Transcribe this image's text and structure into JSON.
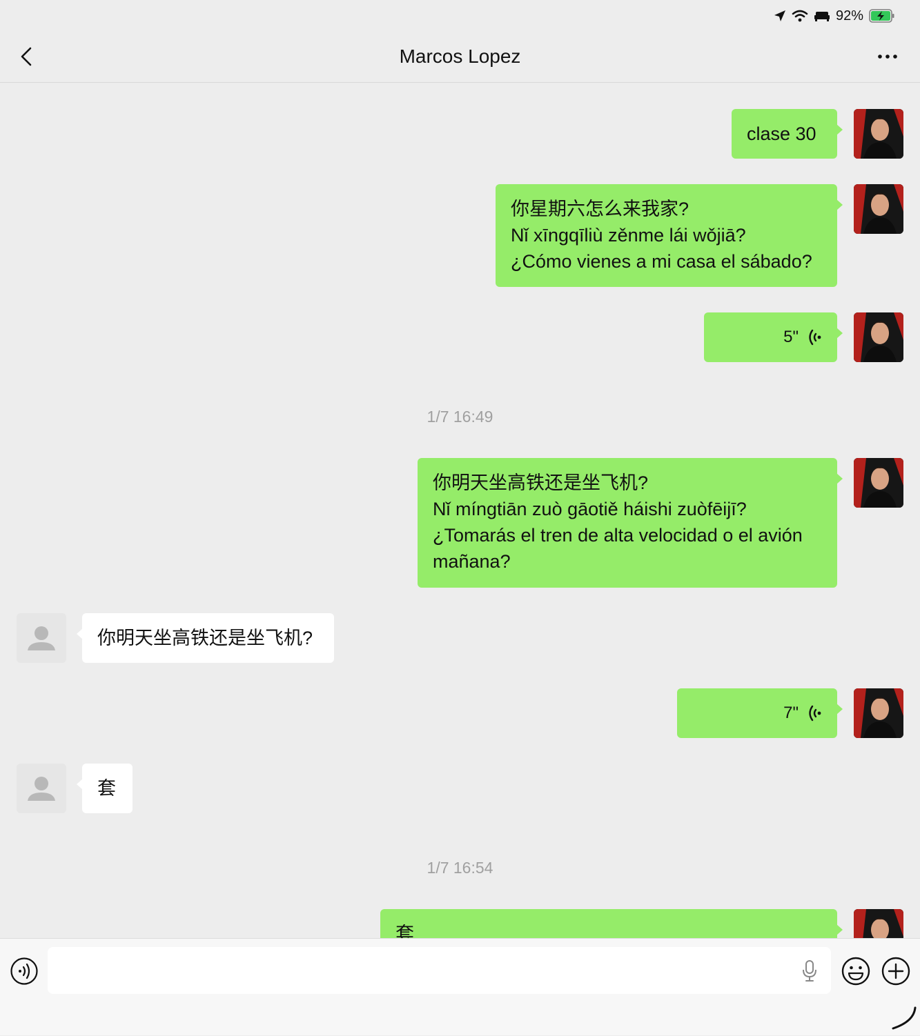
{
  "status_bar": {
    "battery_percent": "92%",
    "battery_level": 0.92,
    "battery_charging": true
  },
  "header": {
    "title": "Marcos Lopez"
  },
  "messages": [
    {
      "type": "text",
      "direction": "out",
      "text": "clase 30"
    },
    {
      "type": "text",
      "direction": "out",
      "text": "你星期六怎么来我家?\nNǐ xīngqīliù zěnme lái wǒjiā?\n¿Cómo vienes a mi casa el sábado?"
    },
    {
      "type": "voice",
      "direction": "out",
      "duration": "5\""
    },
    {
      "type": "timestamp",
      "text": "1/7 16:49"
    },
    {
      "type": "text",
      "direction": "out",
      "text": "你明天坐高铁还是坐飞机?\nNǐ míngtiān zuò gāotiě háishi zuòfēijī?\n¿Tomarás el tren de alta velocidad o el avión\nmañana?"
    },
    {
      "type": "text",
      "direction": "in",
      "text": "你明天坐高铁还是坐飞机?"
    },
    {
      "type": "voice",
      "direction": "out",
      "duration": "7\""
    },
    {
      "type": "text",
      "direction": "in",
      "text": "套"
    },
    {
      "type": "timestamp",
      "text": "1/7 16:54"
    },
    {
      "type": "text",
      "direction": "out",
      "text": "套"
    }
  ],
  "input_bar": {
    "value": "",
    "placeholder": ""
  },
  "colors": {
    "outgoing_bubble": "#95ec69",
    "incoming_bubble": "#ffffff",
    "background": "#ededed"
  }
}
